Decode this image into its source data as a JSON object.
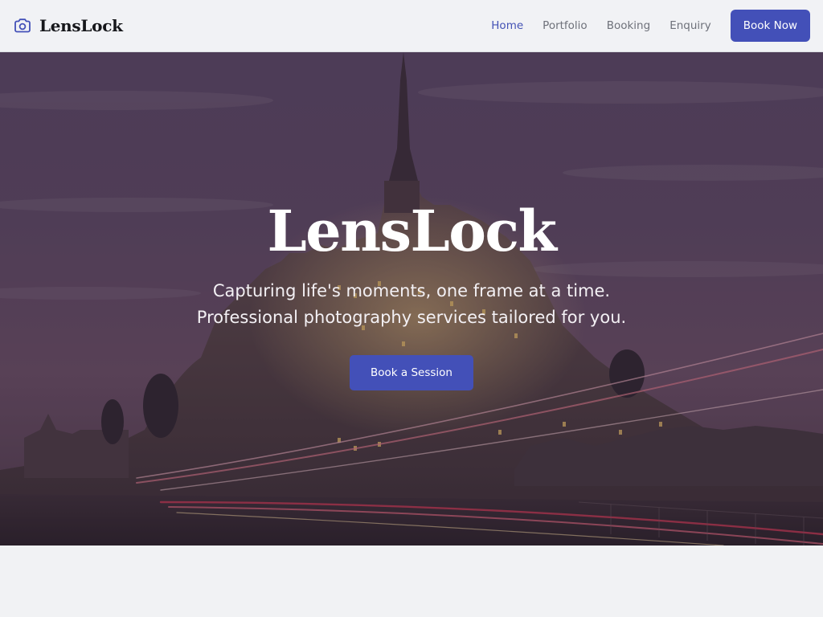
{
  "brand": {
    "icon": "camera-icon",
    "name": "LensLock"
  },
  "nav": {
    "items": [
      {
        "label": "Home",
        "active": true
      },
      {
        "label": "Portfolio",
        "active": false
      },
      {
        "label": "Booking",
        "active": false
      },
      {
        "label": "Enquiry",
        "active": false
      }
    ],
    "cta_label": "Book Now"
  },
  "hero": {
    "title": "LensLock",
    "subtitle": "Capturing life's moments, one frame at a time. Professional photography services tailored for you.",
    "cta_label": "Book a Session",
    "background": "castle-at-dusk-photo"
  },
  "colors": {
    "accent": "#4350b8",
    "active_link": "#4452b5",
    "header_bg": "#f1f2f5",
    "page_bg": "#f1f2f4"
  }
}
